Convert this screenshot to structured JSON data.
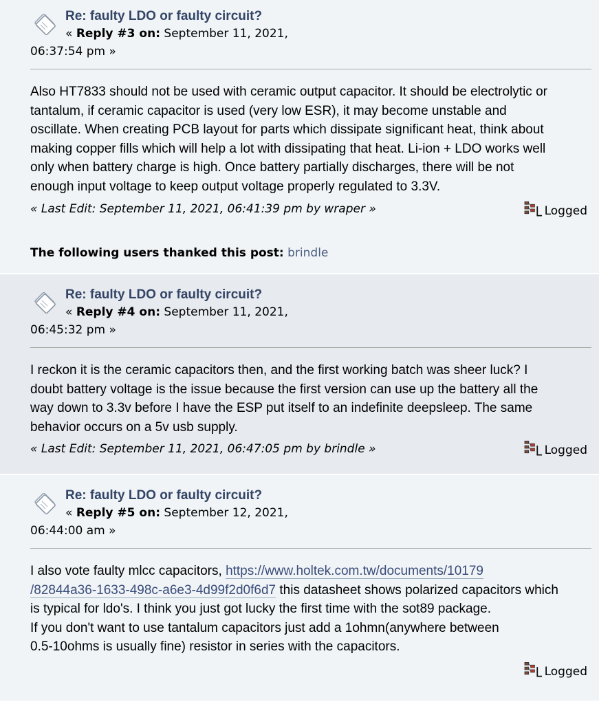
{
  "posts": [
    {
      "subject": "Re: faulty LDO or faulty circuit?",
      "reply_prefix": "«",
      "reply_label": "Reply #3 on:",
      "date_part1": "September 11, 2021,",
      "date_part2": "06:37:54 pm »",
      "body_lines": [
        "Also HT7833 should not be used with ceramic output capacitor. It should be electrolytic or",
        "tantalum, if ceramic capacitor is used (very low ESR), it may become unstable and",
        "oscillate. When creating PCB layout for parts which dissipate significant heat, think about",
        "making copper fills which will help a lot with dissipating that heat. Li-ion + LDO works well",
        "only when battery charge is high. Once battery partially discharges, there will be not",
        "enough input voltage to keep output voltage properly regulated to 3.3V."
      ],
      "last_edit": "« Last Edit: September 11, 2021, 06:41:39 pm by wraper »",
      "logged_label": "Logged",
      "thanked_label": "The following users thanked this post:",
      "thanked_user": "brindle"
    },
    {
      "subject": "Re: faulty LDO or faulty circuit?",
      "reply_prefix": "«",
      "reply_label": "Reply #4 on:",
      "date_part1": "September 11, 2021,",
      "date_part2": "06:45:32 pm »",
      "body_lines": [
        "I reckon it is the ceramic capacitors then, and the first working batch was sheer luck? I",
        "doubt battery voltage is the issue because the first version can use up the battery all the",
        "way down to 3.3v before I have the ESP put itself to an indefinite deepsleep. The same",
        "behavior occurs on a 5v usb supply."
      ],
      "last_edit": "« Last Edit: September 11, 2021, 06:47:05 pm by brindle »",
      "logged_label": "Logged"
    },
    {
      "subject": "Re: faulty LDO or faulty circuit?",
      "reply_prefix": "«",
      "reply_label": "Reply #5 on:",
      "date_part1": "September 12, 2021,",
      "date_part2": "06:44:00 am »",
      "body_line1_text": "I also vote faulty mlcc capacitors, ",
      "link_part1": "https://www.holtek.com.tw/documents/10179",
      "link_part2": "/82844a36-1633-498c-a6e3-4d99f2d0f6d7",
      "body_line2_rest": " this datasheet shows polarized capacitors which",
      "body_rest_lines": [
        "is typical for ldo's.  I think you just got lucky the first time with the sot89 package.",
        "If you don't want to use tantalum capacitors just add a 1ohmn(anywhere between",
        "0.5-10ohms is usually fine) resistor in series with the capacitors."
      ],
      "logged_label": "Logged"
    }
  ],
  "icons": {
    "post": "xx-post-icon",
    "logged": "ip-logged-icon"
  },
  "colors": {
    "subject_link": "#334466",
    "user_link": "#4a5c80",
    "post_bg_light": "#f0f4f7",
    "post_bg_dark": "#e7eaef"
  }
}
